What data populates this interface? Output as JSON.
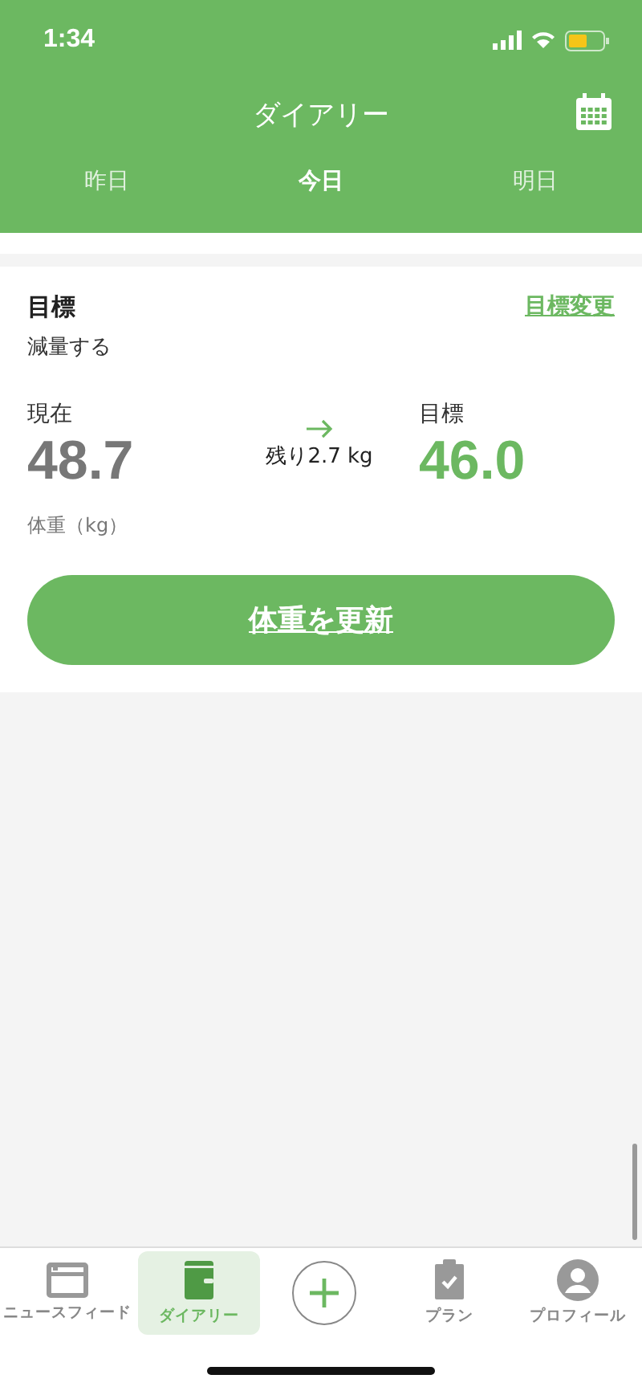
{
  "status_bar": {
    "time": "1:34"
  },
  "header": {
    "title": "ダイアリー"
  },
  "day_tabs": [
    {
      "label": "昨日",
      "selected": false
    },
    {
      "label": "今日",
      "selected": true
    },
    {
      "label": "明日",
      "selected": false
    }
  ],
  "goal_card": {
    "title": "目標",
    "subtitle": "減量する",
    "change_link": "目標変更",
    "current": {
      "label": "現在",
      "value": "48.7"
    },
    "remaining": "残り2.7 kg",
    "target": {
      "label": "目標",
      "value": "46.0"
    },
    "unit": "体重（kg）",
    "update_button": "体重を更新"
  },
  "bottom_nav": [
    {
      "kind": "feed",
      "label": "ニュースフィード",
      "selected": false
    },
    {
      "kind": "diary",
      "label": "ダイアリー",
      "selected": true
    },
    {
      "kind": "add"
    },
    {
      "kind": "plan",
      "label": "プラン",
      "selected": false
    },
    {
      "kind": "profile",
      "label": "プロフィール",
      "selected": false
    }
  ]
}
